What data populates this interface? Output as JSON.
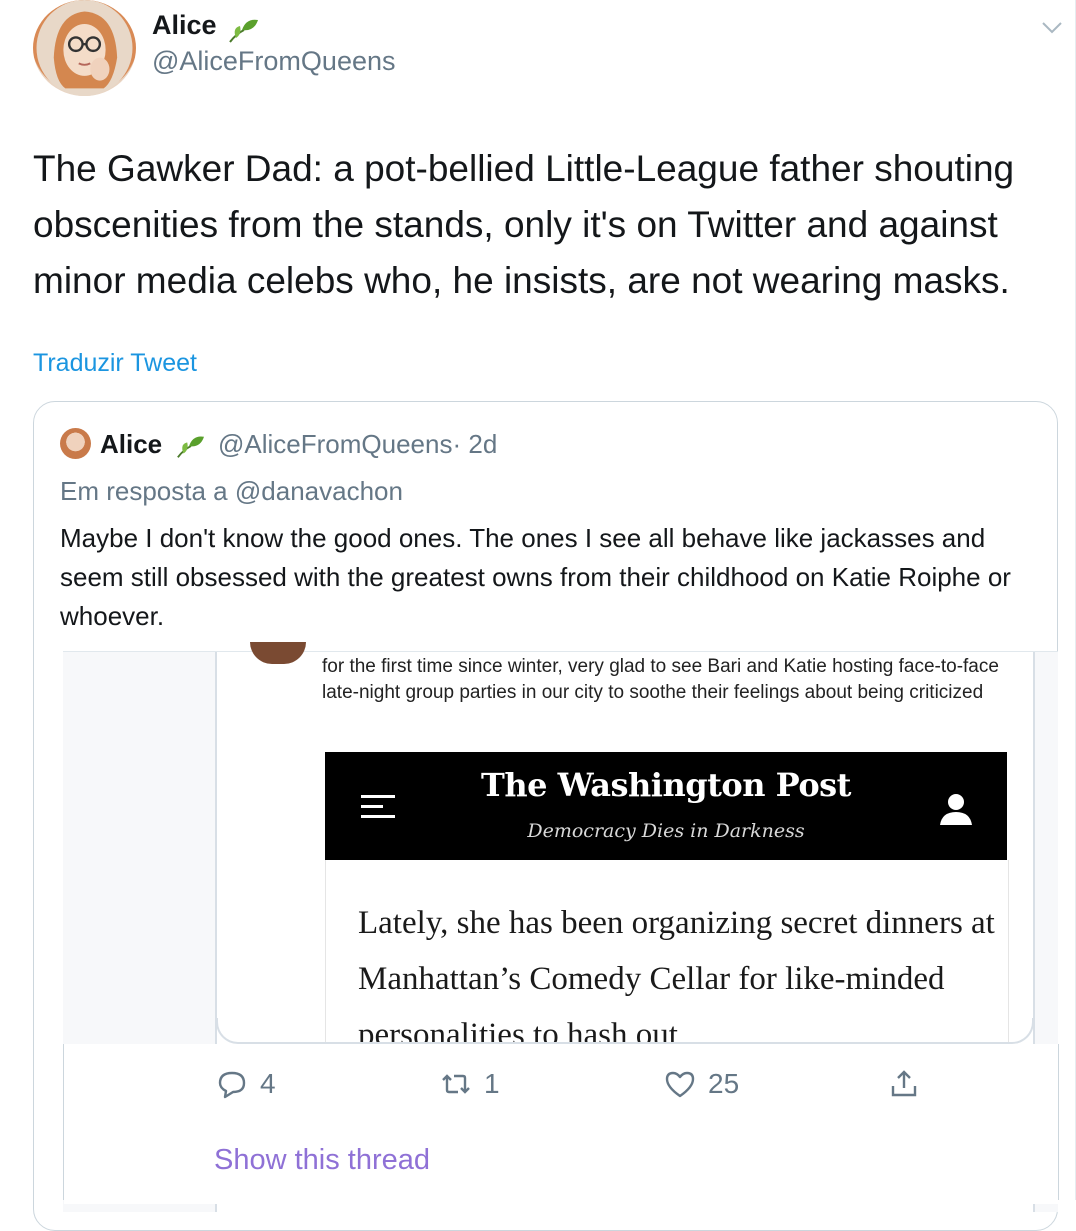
{
  "tweet": {
    "author_name": "Alice",
    "author_handle": "@AliceFromQueens",
    "text": "The Gawker Dad: a pot-bellied Little-League father shouting obscenities from the stands, only it's on Twitter and against minor media celebs who, he insists, are not wearing masks.",
    "translate_label": "Traduzir Tweet"
  },
  "quoted": {
    "author_name": "Alice",
    "author_handle": "@AliceFromQueens",
    "time": "· 2d",
    "reply_prefix": "Em resposta a",
    "reply_to": "@danavachon",
    "text": "Maybe I don't know the good ones. The ones I see all behave like jackasses and seem still obsessed with the greatest owns from their childhood on Katie Roiphe or whoever."
  },
  "embedded": {
    "tweet_text": "for the first time since winter, very glad to see Bari and Katie hosting face-to-face late-night group parties in our city to soothe their feelings about being criticized",
    "masthead": "The Washington Post",
    "tagline": "Democracy Dies in Darkness",
    "article_text": "Lately, she has been organizing secret dinners at Manhattan’s Comedy Cellar for like-minded personalities to hash out"
  },
  "actions": {
    "reply_count": "4",
    "retweet_count": "1",
    "like_count": "25"
  },
  "show_thread_label": "Show this thread",
  "icons": [
    "leaf-emoji-icon",
    "chevron-down-icon",
    "reply-icon",
    "retweet-icon",
    "heart-icon",
    "share-icon",
    "hamburger-menu-icon",
    "user-icon"
  ],
  "colors": {
    "link": "#1b95e0",
    "muted": "#657786",
    "thread": "#8f71d6"
  }
}
